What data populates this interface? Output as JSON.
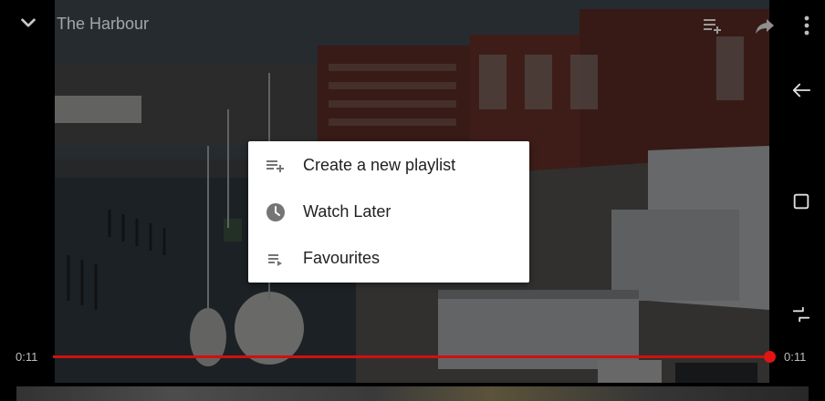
{
  "video": {
    "title": "The Harbour",
    "current_time": "0:11",
    "duration": "0:11",
    "progress": 1.0
  },
  "top_bar": {
    "icons": [
      "chevron-down-icon",
      "add-to-playlist-icon",
      "share-icon",
      "more-vert-icon"
    ]
  },
  "menu": {
    "items": [
      {
        "label": "Create a new playlist",
        "icon": "playlist-add-icon"
      },
      {
        "label": "Watch Later",
        "icon": "clock-icon"
      },
      {
        "label": "Favourites",
        "icon": "playlist-play-icon"
      }
    ]
  },
  "nav": {
    "icons": [
      "back-icon",
      "overview-icon",
      "recents-icon"
    ]
  },
  "colors": {
    "progress": "#d11010",
    "menu_bg": "#ffffff",
    "menu_text": "#212121",
    "menu_icon": "#757575"
  }
}
